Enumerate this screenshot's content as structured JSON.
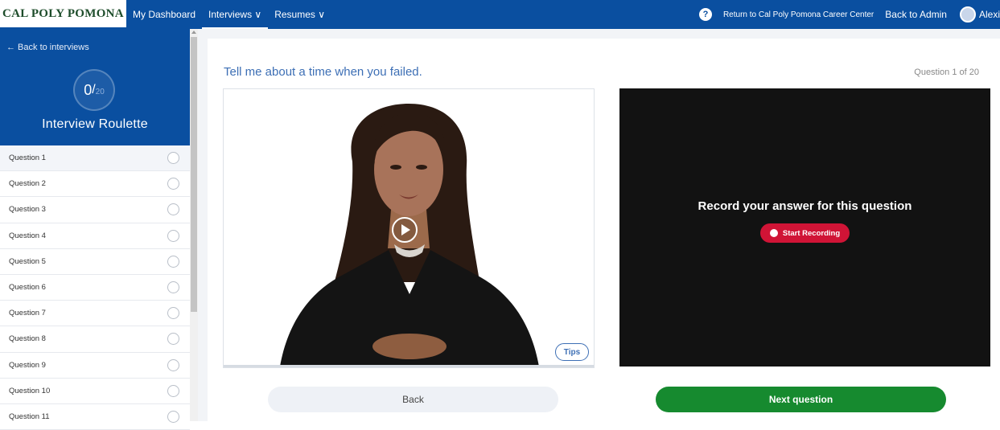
{
  "nav": {
    "logo": "CAL POLY POMONA",
    "dashboard": "My Dashboard",
    "interviews": "Interviews ∨",
    "resumes": "Resumes ∨",
    "help": "?",
    "career_center": "Return to Cal Poly Pomona Career Center",
    "admin": "Back to Admin",
    "user": "Alexi"
  },
  "sidebar": {
    "back": "← Back to interviews",
    "progress_done": "0",
    "progress_slash": "/",
    "progress_total": "20",
    "title": "Interview Roulette",
    "questions": [
      "Question 1",
      "Question 2",
      "Question 3",
      "Question 4",
      "Question 5",
      "Question 6",
      "Question 7",
      "Question 8",
      "Question 9",
      "Question 10",
      "Question 11"
    ]
  },
  "main": {
    "question": "Tell me about a time when you failed.",
    "counter": "Question 1 of 20",
    "tips": "Tips",
    "record_title": "Record your answer for this question",
    "record_button": "Start Recording",
    "back_button": "Back",
    "next_button": "Next question"
  },
  "colors": {
    "nav_blue": "#0a4fa0",
    "accent_blue": "#3d6fb5",
    "record_red": "#d01436",
    "next_green": "#168a2f"
  },
  "icons": {
    "help": "question-circle-icon",
    "avatar": "user-avatar-icon",
    "play": "play-icon",
    "record": "record-dot-icon",
    "question_status": "empty-circle-icon"
  }
}
